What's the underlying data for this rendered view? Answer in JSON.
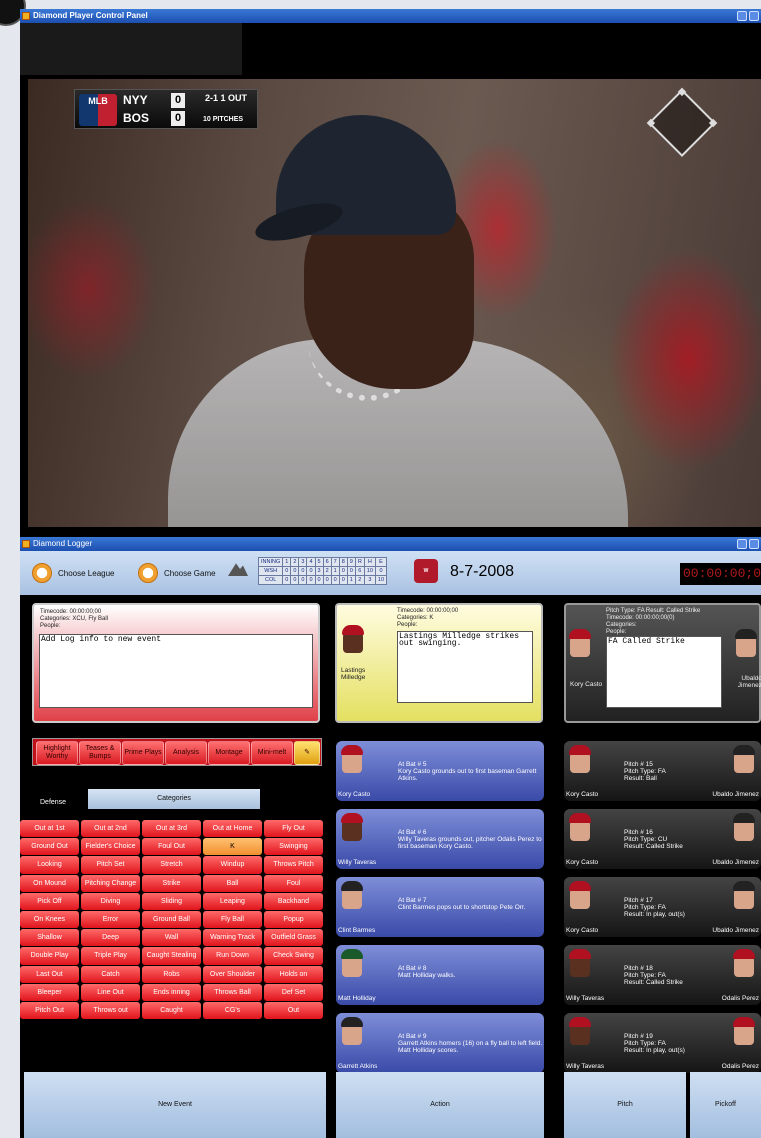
{
  "window1": {
    "title": "Diamond Player Control Panel"
  },
  "scorebug": {
    "logo": "MLB",
    "away_team": "NYY",
    "away_score": "0",
    "home_team": "BOS",
    "home_score": "0",
    "count": "2-1 1 OUT",
    "pitches": "10 PITCHES"
  },
  "window2": {
    "title": "Diamond Logger"
  },
  "toolbar": {
    "choose_league": "Choose League",
    "choose_game": "Choose Game",
    "date": "8-7-2008",
    "timecode": "00:00:00;00"
  },
  "linescore": {
    "header": [
      "INNING",
      "1",
      "2",
      "3",
      "4",
      "5",
      "6",
      "7",
      "8",
      "9",
      "R",
      "H",
      "E"
    ],
    "rows": [
      [
        "WSH",
        "0",
        "0",
        "0",
        "0",
        "3",
        "2",
        "1",
        "0",
        "0",
        "6",
        "10",
        "0"
      ],
      [
        "COL",
        "0",
        "0",
        "0",
        "0",
        "0",
        "0",
        "0",
        "0",
        "1",
        "2",
        "3",
        "10",
        "1"
      ]
    ]
  },
  "new_event_card": {
    "timecode": "Timecode: 00:00:00;00",
    "categories": "Categories: XCU, Fly Ball",
    "people": "People:",
    "text": "Add Log info to new event"
  },
  "action_card": {
    "timecode": "Timecode: 00:00:00;00",
    "categories": "Categories: K",
    "people": "People:",
    "text": "Lastings Milledge strikes out swinging.",
    "player": "Lastings Milledge"
  },
  "pitch_card": {
    "line1": "Pitch Type: FA Result: Called Strike",
    "timecode": "Timecode: 00:00:00;00(0)",
    "categories": "Categories:",
    "people": "People:",
    "text": "FA Called Strike",
    "batter": "Kory Casto",
    "pitcher": "Ubaldo Jimenez"
  },
  "tabs": [
    "Highlight Worthy",
    "Teases & Bumps",
    "Prime Plays",
    "Analysis",
    "Montage",
    "Mini-melt"
  ],
  "defense_label": "Defense",
  "categories_label": "Categories",
  "category_buttons": [
    "Out at 1st",
    "Out at 2nd",
    "Out at 3rd",
    "Out at Home",
    "Fly Out",
    "Ground Out",
    "Fielder's Choice",
    "Foul Out",
    "K",
    "Swinging",
    "Looking",
    "Pitch Set",
    "Stretch",
    "Windup",
    "Throws Pitch",
    "On Mound",
    "Pitching Change",
    "Strike",
    "Ball",
    "Foul",
    "Pick Off",
    "Diving",
    "Sliding",
    "Leaping",
    "Backhand",
    "On Knees",
    "Error",
    "Ground Ball",
    "Fly Ball",
    "Popup",
    "Shallow",
    "Deep",
    "Wall",
    "Warning Track",
    "Outfield Grass",
    "Double Play",
    "Triple Play",
    "Caught Stealing",
    "Run Down",
    "Check Swing",
    "Last Out",
    "Catch",
    "Robs",
    "Over Shoulder",
    "Holds on",
    "Bleeper",
    "Line Out",
    "Ends inning",
    "Throws Ball",
    "Def Set",
    "Pitch Out",
    "Throws out",
    "Caught",
    "CG's",
    "Out"
  ],
  "at_bats": [
    {
      "title": "At Bat # 5",
      "text": "Kory Casto grounds out to first baseman Garrett Atkins.",
      "player": "Kory Casto"
    },
    {
      "title": "At Bat # 6",
      "text": "Willy Taveras grounds out, pitcher Odalis Perez to first baseman Kory Casto.",
      "player": "Willy Taveras"
    },
    {
      "title": "At Bat # 7",
      "text": "Clint Barmes pops out to shortstop Pete Orr.",
      "player": "Clint Barmes"
    },
    {
      "title": "At Bat # 8",
      "text": "Matt Holliday walks.",
      "player": "Matt Holliday"
    },
    {
      "title": "At Bat # 9",
      "text": "Garrett Atkins homers (16) on a fly ball to left field. Matt Holliday scores.",
      "player": "Garrett Atkins"
    }
  ],
  "pitches": [
    {
      "number": "Pitch # 15",
      "type": "Pitch Type: FA",
      "result": "Result: Ball",
      "batter": "Kory Casto",
      "pitcher": "Ubaldo Jimenez"
    },
    {
      "number": "Pitch # 16",
      "type": "Pitch Type: CU",
      "result": "Result: Called Strike",
      "batter": "Kory Casto",
      "pitcher": "Ubaldo Jimenez"
    },
    {
      "number": "Pitch # 17",
      "type": "Pitch Type: FA",
      "result": "Result: In play, out(s)",
      "batter": "Kory Casto",
      "pitcher": "Ubaldo Jimenez"
    },
    {
      "number": "Pitch # 18",
      "type": "Pitch Type: FA",
      "result": "Result: Called Strike",
      "batter": "Willy Taveras",
      "pitcher": "Odalis Perez"
    },
    {
      "number": "Pitch # 19",
      "type": "Pitch Type: FA",
      "result": "Result: In play, out(s)",
      "batter": "Willy Taveras",
      "pitcher": "Odalis Perez"
    }
  ],
  "buttons": {
    "new_event": "New Event",
    "action": "Action",
    "pitch": "Pitch",
    "pickoff": "Pickoff"
  }
}
